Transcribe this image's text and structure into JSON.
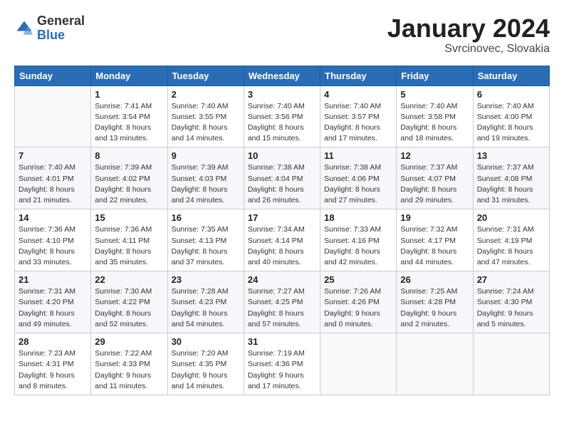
{
  "header": {
    "logo": {
      "general": "General",
      "blue": "Blue"
    },
    "title": "January 2024",
    "location": "Svrcinovec, Slovakia"
  },
  "days_of_week": [
    "Sunday",
    "Monday",
    "Tuesday",
    "Wednesday",
    "Thursday",
    "Friday",
    "Saturday"
  ],
  "weeks": [
    [
      {
        "num": "",
        "detail": ""
      },
      {
        "num": "1",
        "detail": "Sunrise: 7:41 AM\nSunset: 3:54 PM\nDaylight: 8 hours\nand 13 minutes."
      },
      {
        "num": "2",
        "detail": "Sunrise: 7:40 AM\nSunset: 3:55 PM\nDaylight: 8 hours\nand 14 minutes."
      },
      {
        "num": "3",
        "detail": "Sunrise: 7:40 AM\nSunset: 3:56 PM\nDaylight: 8 hours\nand 15 minutes."
      },
      {
        "num": "4",
        "detail": "Sunrise: 7:40 AM\nSunset: 3:57 PM\nDaylight: 8 hours\nand 17 minutes."
      },
      {
        "num": "5",
        "detail": "Sunrise: 7:40 AM\nSunset: 3:58 PM\nDaylight: 8 hours\nand 18 minutes."
      },
      {
        "num": "6",
        "detail": "Sunrise: 7:40 AM\nSunset: 4:00 PM\nDaylight: 8 hours\nand 19 minutes."
      }
    ],
    [
      {
        "num": "7",
        "detail": "Sunrise: 7:40 AM\nSunset: 4:01 PM\nDaylight: 8 hours\nand 21 minutes."
      },
      {
        "num": "8",
        "detail": "Sunrise: 7:39 AM\nSunset: 4:02 PM\nDaylight: 8 hours\nand 22 minutes."
      },
      {
        "num": "9",
        "detail": "Sunrise: 7:39 AM\nSunset: 4:03 PM\nDaylight: 8 hours\nand 24 minutes."
      },
      {
        "num": "10",
        "detail": "Sunrise: 7:38 AM\nSunset: 4:04 PM\nDaylight: 8 hours\nand 26 minutes."
      },
      {
        "num": "11",
        "detail": "Sunrise: 7:38 AM\nSunset: 4:06 PM\nDaylight: 8 hours\nand 27 minutes."
      },
      {
        "num": "12",
        "detail": "Sunrise: 7:37 AM\nSunset: 4:07 PM\nDaylight: 8 hours\nand 29 minutes."
      },
      {
        "num": "13",
        "detail": "Sunrise: 7:37 AM\nSunset: 4:08 PM\nDaylight: 8 hours\nand 31 minutes."
      }
    ],
    [
      {
        "num": "14",
        "detail": "Sunrise: 7:36 AM\nSunset: 4:10 PM\nDaylight: 8 hours\nand 33 minutes."
      },
      {
        "num": "15",
        "detail": "Sunrise: 7:36 AM\nSunset: 4:11 PM\nDaylight: 8 hours\nand 35 minutes."
      },
      {
        "num": "16",
        "detail": "Sunrise: 7:35 AM\nSunset: 4:13 PM\nDaylight: 8 hours\nand 37 minutes."
      },
      {
        "num": "17",
        "detail": "Sunrise: 7:34 AM\nSunset: 4:14 PM\nDaylight: 8 hours\nand 40 minutes."
      },
      {
        "num": "18",
        "detail": "Sunrise: 7:33 AM\nSunset: 4:16 PM\nDaylight: 8 hours\nand 42 minutes."
      },
      {
        "num": "19",
        "detail": "Sunrise: 7:32 AM\nSunset: 4:17 PM\nDaylight: 8 hours\nand 44 minutes."
      },
      {
        "num": "20",
        "detail": "Sunrise: 7:31 AM\nSunset: 4:19 PM\nDaylight: 8 hours\nand 47 minutes."
      }
    ],
    [
      {
        "num": "21",
        "detail": "Sunrise: 7:31 AM\nSunset: 4:20 PM\nDaylight: 8 hours\nand 49 minutes."
      },
      {
        "num": "22",
        "detail": "Sunrise: 7:30 AM\nSunset: 4:22 PM\nDaylight: 8 hours\nand 52 minutes."
      },
      {
        "num": "23",
        "detail": "Sunrise: 7:28 AM\nSunset: 4:23 PM\nDaylight: 8 hours\nand 54 minutes."
      },
      {
        "num": "24",
        "detail": "Sunrise: 7:27 AM\nSunset: 4:25 PM\nDaylight: 8 hours\nand 57 minutes."
      },
      {
        "num": "25",
        "detail": "Sunrise: 7:26 AM\nSunset: 4:26 PM\nDaylight: 9 hours\nand 0 minutes."
      },
      {
        "num": "26",
        "detail": "Sunrise: 7:25 AM\nSunset: 4:28 PM\nDaylight: 9 hours\nand 2 minutes."
      },
      {
        "num": "27",
        "detail": "Sunrise: 7:24 AM\nSunset: 4:30 PM\nDaylight: 9 hours\nand 5 minutes."
      }
    ],
    [
      {
        "num": "28",
        "detail": "Sunrise: 7:23 AM\nSunset: 4:31 PM\nDaylight: 9 hours\nand 8 minutes."
      },
      {
        "num": "29",
        "detail": "Sunrise: 7:22 AM\nSunset: 4:33 PM\nDaylight: 9 hours\nand 11 minutes."
      },
      {
        "num": "30",
        "detail": "Sunrise: 7:20 AM\nSunset: 4:35 PM\nDaylight: 9 hours\nand 14 minutes."
      },
      {
        "num": "31",
        "detail": "Sunrise: 7:19 AM\nSunset: 4:36 PM\nDaylight: 9 hours\nand 17 minutes."
      },
      {
        "num": "",
        "detail": ""
      },
      {
        "num": "",
        "detail": ""
      },
      {
        "num": "",
        "detail": ""
      }
    ]
  ]
}
